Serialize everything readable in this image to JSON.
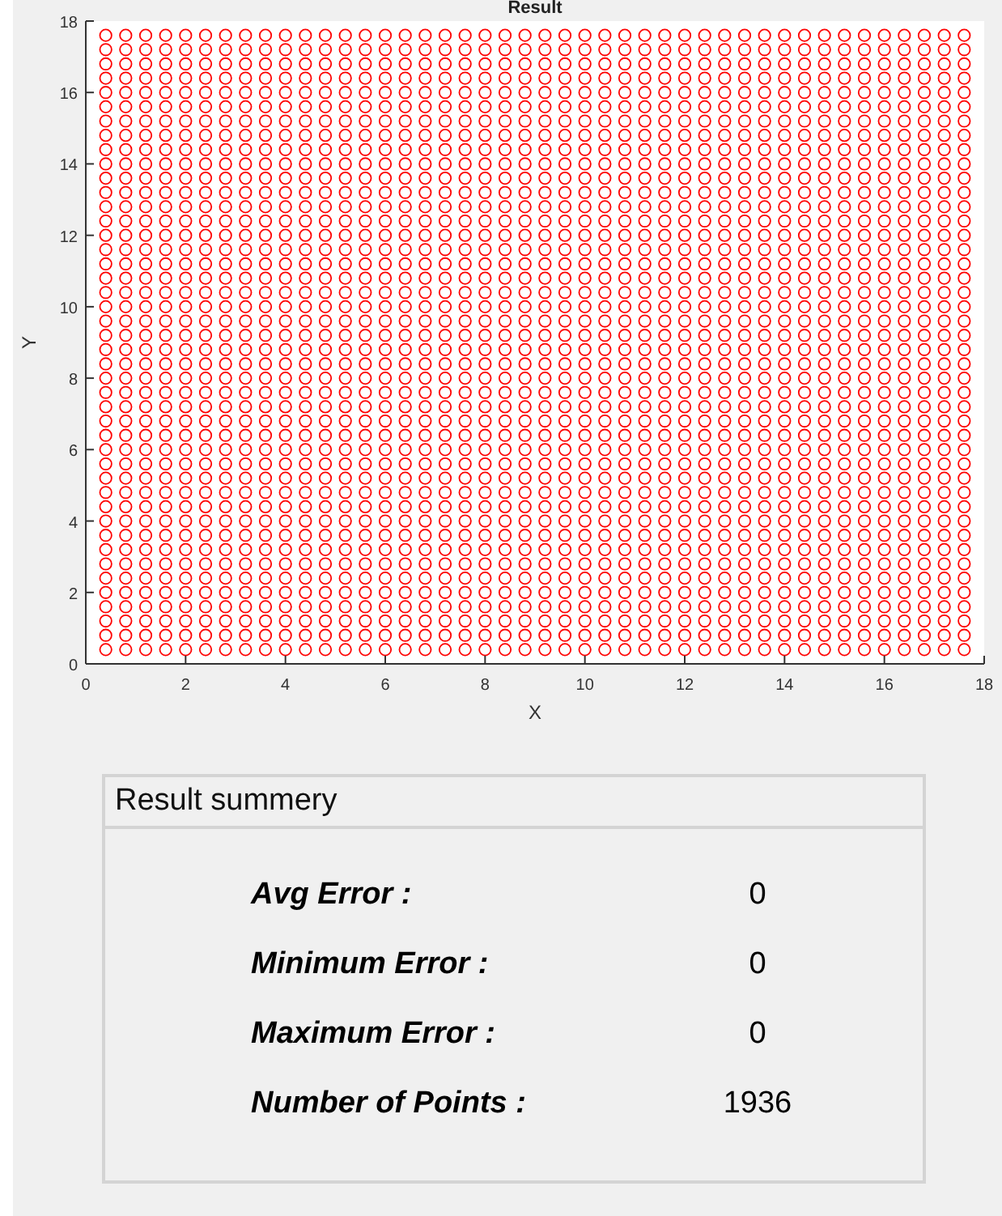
{
  "figure": {
    "chart_data": {
      "type": "scatter",
      "title": "Result",
      "xlabel": "X",
      "ylabel": "Y",
      "xlim": [
        0,
        18
      ],
      "ylim": [
        0,
        18
      ],
      "xticks": [
        0,
        2,
        4,
        6,
        8,
        10,
        12,
        14,
        16,
        18
      ],
      "yticks": [
        0,
        2,
        4,
        6,
        8,
        10,
        12,
        14,
        16,
        18
      ],
      "x": [
        0.4,
        0.8,
        1.2,
        1.6,
        2,
        2.4,
        2.8,
        3.2,
        3.6,
        4,
        4.4,
        4.8,
        5.2,
        5.6,
        6,
        6.4,
        6.8,
        7.2,
        7.6,
        8,
        8.4,
        8.8,
        9.2,
        9.6,
        10,
        10.4,
        10.8,
        11.2,
        11.6,
        12,
        12.4,
        12.8,
        13.2,
        13.6,
        14,
        14.4,
        14.8,
        15.2,
        15.6,
        16,
        16.4,
        16.8,
        17.2,
        17.6
      ],
      "series": [
        {
          "color": "#ff0000",
          "values": [
            0.4,
            0.4,
            0.4,
            0.4,
            0.4,
            0.4,
            0.4,
            0.4,
            0.4,
            0.4,
            0.4,
            0.4,
            0.4,
            0.4,
            0.4,
            0.4,
            0.4,
            0.4,
            0.4,
            0.4,
            0.4,
            0.4,
            0.4,
            0.4,
            0.4,
            0.4,
            0.4,
            0.4,
            0.4,
            0.4,
            0.4,
            0.4,
            0.4,
            0.4,
            0.4,
            0.4,
            0.4,
            0.4,
            0.4,
            0.4,
            0.4,
            0.4,
            0.4,
            0.4
          ]
        },
        {
          "color": "#ff0000",
          "values": [
            0.8,
            0.8,
            0.8,
            0.8,
            0.8,
            0.8,
            0.8,
            0.8,
            0.8,
            0.8,
            0.8,
            0.8,
            0.8,
            0.8,
            0.8,
            0.8,
            0.8,
            0.8,
            0.8,
            0.8,
            0.8,
            0.8,
            0.8,
            0.8,
            0.8,
            0.8,
            0.8,
            0.8,
            0.8,
            0.8,
            0.8,
            0.8,
            0.8,
            0.8,
            0.8,
            0.8,
            0.8,
            0.8,
            0.8,
            0.8,
            0.8,
            0.8,
            0.8,
            0.8
          ]
        },
        {
          "color": "#ff0000",
          "values": [
            1.2,
            1.2,
            1.2,
            1.2,
            1.2,
            1.2,
            1.2,
            1.2,
            1.2,
            1.2,
            1.2,
            1.2,
            1.2,
            1.2,
            1.2,
            1.2,
            1.2,
            1.2,
            1.2,
            1.2,
            1.2,
            1.2,
            1.2,
            1.2,
            1.2,
            1.2,
            1.2,
            1.2,
            1.2,
            1.2,
            1.2,
            1.2,
            1.2,
            1.2,
            1.2,
            1.2,
            1.2,
            1.2,
            1.2,
            1.2,
            1.2,
            1.2,
            1.2,
            1.2
          ]
        },
        {
          "color": "#ff0000",
          "values": [
            1.6,
            1.6,
            1.6,
            1.6,
            1.6,
            1.6,
            1.6,
            1.6,
            1.6,
            1.6,
            1.6,
            1.6,
            1.6,
            1.6,
            1.6,
            1.6,
            1.6,
            1.6,
            1.6,
            1.6,
            1.6,
            1.6,
            1.6,
            1.6,
            1.6,
            1.6,
            1.6,
            1.6,
            1.6,
            1.6,
            1.6,
            1.6,
            1.6,
            1.6,
            1.6,
            1.6,
            1.6,
            1.6,
            1.6,
            1.6,
            1.6,
            1.6,
            1.6,
            1.6
          ]
        },
        {
          "color": "#ff0000",
          "values": [
            2,
            2,
            2,
            2,
            2,
            2,
            2,
            2,
            2,
            2,
            2,
            2,
            2,
            2,
            2,
            2,
            2,
            2,
            2,
            2,
            2,
            2,
            2,
            2,
            2,
            2,
            2,
            2,
            2,
            2,
            2,
            2,
            2,
            2,
            2,
            2,
            2,
            2,
            2,
            2,
            2,
            2,
            2,
            2
          ]
        },
        {
          "color": "#ff0000",
          "values": [
            2.4,
            2.4,
            2.4,
            2.4,
            2.4,
            2.4,
            2.4,
            2.4,
            2.4,
            2.4,
            2.4,
            2.4,
            2.4,
            2.4,
            2.4,
            2.4,
            2.4,
            2.4,
            2.4,
            2.4,
            2.4,
            2.4,
            2.4,
            2.4,
            2.4,
            2.4,
            2.4,
            2.4,
            2.4,
            2.4,
            2.4,
            2.4,
            2.4,
            2.4,
            2.4,
            2.4,
            2.4,
            2.4,
            2.4,
            2.4,
            2.4,
            2.4,
            2.4,
            2.4
          ]
        },
        {
          "color": "#ff0000",
          "values": [
            2.8,
            2.8,
            2.8,
            2.8,
            2.8,
            2.8,
            2.8,
            2.8,
            2.8,
            2.8,
            2.8,
            2.8,
            2.8,
            2.8,
            2.8,
            2.8,
            2.8,
            2.8,
            2.8,
            2.8,
            2.8,
            2.8,
            2.8,
            2.8,
            2.8,
            2.8,
            2.8,
            2.8,
            2.8,
            2.8,
            2.8,
            2.8,
            2.8,
            2.8,
            2.8,
            2.8,
            2.8,
            2.8,
            2.8,
            2.8,
            2.8,
            2.8,
            2.8,
            2.8
          ]
        },
        {
          "color": "#ff0000",
          "values": [
            3.2,
            3.2,
            3.2,
            3.2,
            3.2,
            3.2,
            3.2,
            3.2,
            3.2,
            3.2,
            3.2,
            3.2,
            3.2,
            3.2,
            3.2,
            3.2,
            3.2,
            3.2,
            3.2,
            3.2,
            3.2,
            3.2,
            3.2,
            3.2,
            3.2,
            3.2,
            3.2,
            3.2,
            3.2,
            3.2,
            3.2,
            3.2,
            3.2,
            3.2,
            3.2,
            3.2,
            3.2,
            3.2,
            3.2,
            3.2,
            3.2,
            3.2,
            3.2,
            3.2
          ]
        },
        {
          "color": "#ff0000",
          "values": [
            3.6,
            3.6,
            3.6,
            3.6,
            3.6,
            3.6,
            3.6,
            3.6,
            3.6,
            3.6,
            3.6,
            3.6,
            3.6,
            3.6,
            3.6,
            3.6,
            3.6,
            3.6,
            3.6,
            3.6,
            3.6,
            3.6,
            3.6,
            3.6,
            3.6,
            3.6,
            3.6,
            3.6,
            3.6,
            3.6,
            3.6,
            3.6,
            3.6,
            3.6,
            3.6,
            3.6,
            3.6,
            3.6,
            3.6,
            3.6,
            3.6,
            3.6,
            3.6,
            3.6
          ]
        },
        {
          "color": "#ff0000",
          "values": [
            4,
            4,
            4,
            4,
            4,
            4,
            4,
            4,
            4,
            4,
            4,
            4,
            4,
            4,
            4,
            4,
            4,
            4,
            4,
            4,
            4,
            4,
            4,
            4,
            4,
            4,
            4,
            4,
            4,
            4,
            4,
            4,
            4,
            4,
            4,
            4,
            4,
            4,
            4,
            4,
            4,
            4,
            4,
            4
          ]
        },
        {
          "color": "#ff0000",
          "values": [
            4.4,
            4.4,
            4.4,
            4.4,
            4.4,
            4.4,
            4.4,
            4.4,
            4.4,
            4.4,
            4.4,
            4.4,
            4.4,
            4.4,
            4.4,
            4.4,
            4.4,
            4.4,
            4.4,
            4.4,
            4.4,
            4.4,
            4.4,
            4.4,
            4.4,
            4.4,
            4.4,
            4.4,
            4.4,
            4.4,
            4.4,
            4.4,
            4.4,
            4.4,
            4.4,
            4.4,
            4.4,
            4.4,
            4.4,
            4.4,
            4.4,
            4.4,
            4.4,
            4.4
          ]
        },
        {
          "color": "#ff0000",
          "values": [
            4.8,
            4.8,
            4.8,
            4.8,
            4.8,
            4.8,
            4.8,
            4.8,
            4.8,
            4.8,
            4.8,
            4.8,
            4.8,
            4.8,
            4.8,
            4.8,
            4.8,
            4.8,
            4.8,
            4.8,
            4.8,
            4.8,
            4.8,
            4.8,
            4.8,
            4.8,
            4.8,
            4.8,
            4.8,
            4.8,
            4.8,
            4.8,
            4.8,
            4.8,
            4.8,
            4.8,
            4.8,
            4.8,
            4.8,
            4.8,
            4.8,
            4.8,
            4.8,
            4.8
          ]
        },
        {
          "color": "#ff0000",
          "values": [
            5.2,
            5.2,
            5.2,
            5.2,
            5.2,
            5.2,
            5.2,
            5.2,
            5.2,
            5.2,
            5.2,
            5.2,
            5.2,
            5.2,
            5.2,
            5.2,
            5.2,
            5.2,
            5.2,
            5.2,
            5.2,
            5.2,
            5.2,
            5.2,
            5.2,
            5.2,
            5.2,
            5.2,
            5.2,
            5.2,
            5.2,
            5.2,
            5.2,
            5.2,
            5.2,
            5.2,
            5.2,
            5.2,
            5.2,
            5.2,
            5.2,
            5.2,
            5.2,
            5.2
          ]
        },
        {
          "color": "#ff0000",
          "values": [
            5.6,
            5.6,
            5.6,
            5.6,
            5.6,
            5.6,
            5.6,
            5.6,
            5.6,
            5.6,
            5.6,
            5.6,
            5.6,
            5.6,
            5.6,
            5.6,
            5.6,
            5.6,
            5.6,
            5.6,
            5.6,
            5.6,
            5.6,
            5.6,
            5.6,
            5.6,
            5.6,
            5.6,
            5.6,
            5.6,
            5.6,
            5.6,
            5.6,
            5.6,
            5.6,
            5.6,
            5.6,
            5.6,
            5.6,
            5.6,
            5.6,
            5.6,
            5.6,
            5.6
          ]
        },
        {
          "color": "#ff0000",
          "values": [
            6,
            6,
            6,
            6,
            6,
            6,
            6,
            6,
            6,
            6,
            6,
            6,
            6,
            6,
            6,
            6,
            6,
            6,
            6,
            6,
            6,
            6,
            6,
            6,
            6,
            6,
            6,
            6,
            6,
            6,
            6,
            6,
            6,
            6,
            6,
            6,
            6,
            6,
            6,
            6,
            6,
            6,
            6,
            6
          ]
        },
        {
          "color": "#ff0000",
          "values": [
            6.4,
            6.4,
            6.4,
            6.4,
            6.4,
            6.4,
            6.4,
            6.4,
            6.4,
            6.4,
            6.4,
            6.4,
            6.4,
            6.4,
            6.4,
            6.4,
            6.4,
            6.4,
            6.4,
            6.4,
            6.4,
            6.4,
            6.4,
            6.4,
            6.4,
            6.4,
            6.4,
            6.4,
            6.4,
            6.4,
            6.4,
            6.4,
            6.4,
            6.4,
            6.4,
            6.4,
            6.4,
            6.4,
            6.4,
            6.4,
            6.4,
            6.4,
            6.4,
            6.4
          ]
        },
        {
          "color": "#ff0000",
          "values": [
            6.8,
            6.8,
            6.8,
            6.8,
            6.8,
            6.8,
            6.8,
            6.8,
            6.8,
            6.8,
            6.8,
            6.8,
            6.8,
            6.8,
            6.8,
            6.8,
            6.8,
            6.8,
            6.8,
            6.8,
            6.8,
            6.8,
            6.8,
            6.8,
            6.8,
            6.8,
            6.8,
            6.8,
            6.8,
            6.8,
            6.8,
            6.8,
            6.8,
            6.8,
            6.8,
            6.8,
            6.8,
            6.8,
            6.8,
            6.8,
            6.8,
            6.8,
            6.8,
            6.8
          ]
        },
        {
          "color": "#ff0000",
          "values": [
            7.2,
            7.2,
            7.2,
            7.2,
            7.2,
            7.2,
            7.2,
            7.2,
            7.2,
            7.2,
            7.2,
            7.2,
            7.2,
            7.2,
            7.2,
            7.2,
            7.2,
            7.2,
            7.2,
            7.2,
            7.2,
            7.2,
            7.2,
            7.2,
            7.2,
            7.2,
            7.2,
            7.2,
            7.2,
            7.2,
            7.2,
            7.2,
            7.2,
            7.2,
            7.2,
            7.2,
            7.2,
            7.2,
            7.2,
            7.2,
            7.2,
            7.2,
            7.2,
            7.2
          ]
        },
        {
          "color": "#ff0000",
          "values": [
            7.6,
            7.6,
            7.6,
            7.6,
            7.6,
            7.6,
            7.6,
            7.6,
            7.6,
            7.6,
            7.6,
            7.6,
            7.6,
            7.6,
            7.6,
            7.6,
            7.6,
            7.6,
            7.6,
            7.6,
            7.6,
            7.6,
            7.6,
            7.6,
            7.6,
            7.6,
            7.6,
            7.6,
            7.6,
            7.6,
            7.6,
            7.6,
            7.6,
            7.6,
            7.6,
            7.6,
            7.6,
            7.6,
            7.6,
            7.6,
            7.6,
            7.6,
            7.6,
            7.6
          ]
        },
        {
          "color": "#ff0000",
          "values": [
            8,
            8,
            8,
            8,
            8,
            8,
            8,
            8,
            8,
            8,
            8,
            8,
            8,
            8,
            8,
            8,
            8,
            8,
            8,
            8,
            8,
            8,
            8,
            8,
            8,
            8,
            8,
            8,
            8,
            8,
            8,
            8,
            8,
            8,
            8,
            8,
            8,
            8,
            8,
            8,
            8,
            8,
            8,
            8
          ]
        },
        {
          "color": "#ff0000",
          "values": [
            8.4,
            8.4,
            8.4,
            8.4,
            8.4,
            8.4,
            8.4,
            8.4,
            8.4,
            8.4,
            8.4,
            8.4,
            8.4,
            8.4,
            8.4,
            8.4,
            8.4,
            8.4,
            8.4,
            8.4,
            8.4,
            8.4,
            8.4,
            8.4,
            8.4,
            8.4,
            8.4,
            8.4,
            8.4,
            8.4,
            8.4,
            8.4,
            8.4,
            8.4,
            8.4,
            8.4,
            8.4,
            8.4,
            8.4,
            8.4,
            8.4,
            8.4,
            8.4,
            8.4
          ]
        },
        {
          "color": "#ff0000",
          "values": [
            8.8,
            8.8,
            8.8,
            8.8,
            8.8,
            8.8,
            8.8,
            8.8,
            8.8,
            8.8,
            8.8,
            8.8,
            8.8,
            8.8,
            8.8,
            8.8,
            8.8,
            8.8,
            8.8,
            8.8,
            8.8,
            8.8,
            8.8,
            8.8,
            8.8,
            8.8,
            8.8,
            8.8,
            8.8,
            8.8,
            8.8,
            8.8,
            8.8,
            8.8,
            8.8,
            8.8,
            8.8,
            8.8,
            8.8,
            8.8,
            8.8,
            8.8,
            8.8,
            8.8
          ]
        },
        {
          "color": "#ff0000",
          "values": [
            9.2,
            9.2,
            9.2,
            9.2,
            9.2,
            9.2,
            9.2,
            9.2,
            9.2,
            9.2,
            9.2,
            9.2,
            9.2,
            9.2,
            9.2,
            9.2,
            9.2,
            9.2,
            9.2,
            9.2,
            9.2,
            9.2,
            9.2,
            9.2,
            9.2,
            9.2,
            9.2,
            9.2,
            9.2,
            9.2,
            9.2,
            9.2,
            9.2,
            9.2,
            9.2,
            9.2,
            9.2,
            9.2,
            9.2,
            9.2,
            9.2,
            9.2,
            9.2,
            9.2
          ]
        },
        {
          "color": "#ff0000",
          "values": [
            9.6,
            9.6,
            9.6,
            9.6,
            9.6,
            9.6,
            9.6,
            9.6,
            9.6,
            9.6,
            9.6,
            9.6,
            9.6,
            9.6,
            9.6,
            9.6,
            9.6,
            9.6,
            9.6,
            9.6,
            9.6,
            9.6,
            9.6,
            9.6,
            9.6,
            9.6,
            9.6,
            9.6,
            9.6,
            9.6,
            9.6,
            9.6,
            9.6,
            9.6,
            9.6,
            9.6,
            9.6,
            9.6,
            9.6,
            9.6,
            9.6,
            9.6,
            9.6,
            9.6
          ]
        },
        {
          "color": "#ff0000",
          "values": [
            10,
            10,
            10,
            10,
            10,
            10,
            10,
            10,
            10,
            10,
            10,
            10,
            10,
            10,
            10,
            10,
            10,
            10,
            10,
            10,
            10,
            10,
            10,
            10,
            10,
            10,
            10,
            10,
            10,
            10,
            10,
            10,
            10,
            10,
            10,
            10,
            10,
            10,
            10,
            10,
            10,
            10,
            10,
            10
          ]
        },
        {
          "color": "#ff0000",
          "values": [
            10.4,
            10.4,
            10.4,
            10.4,
            10.4,
            10.4,
            10.4,
            10.4,
            10.4,
            10.4,
            10.4,
            10.4,
            10.4,
            10.4,
            10.4,
            10.4,
            10.4,
            10.4,
            10.4,
            10.4,
            10.4,
            10.4,
            10.4,
            10.4,
            10.4,
            10.4,
            10.4,
            10.4,
            10.4,
            10.4,
            10.4,
            10.4,
            10.4,
            10.4,
            10.4,
            10.4,
            10.4,
            10.4,
            10.4,
            10.4,
            10.4,
            10.4,
            10.4,
            10.4
          ]
        },
        {
          "color": "#ff0000",
          "values": [
            10.8,
            10.8,
            10.8,
            10.8,
            10.8,
            10.8,
            10.8,
            10.8,
            10.8,
            10.8,
            10.8,
            10.8,
            10.8,
            10.8,
            10.8,
            10.8,
            10.8,
            10.8,
            10.8,
            10.8,
            10.8,
            10.8,
            10.8,
            10.8,
            10.8,
            10.8,
            10.8,
            10.8,
            10.8,
            10.8,
            10.8,
            10.8,
            10.8,
            10.8,
            10.8,
            10.8,
            10.8,
            10.8,
            10.8,
            10.8,
            10.8,
            10.8,
            10.8,
            10.8
          ]
        },
        {
          "color": "#ff0000",
          "values": [
            11.2,
            11.2,
            11.2,
            11.2,
            11.2,
            11.2,
            11.2,
            11.2,
            11.2,
            11.2,
            11.2,
            11.2,
            11.2,
            11.2,
            11.2,
            11.2,
            11.2,
            11.2,
            11.2,
            11.2,
            11.2,
            11.2,
            11.2,
            11.2,
            11.2,
            11.2,
            11.2,
            11.2,
            11.2,
            11.2,
            11.2,
            11.2,
            11.2,
            11.2,
            11.2,
            11.2,
            11.2,
            11.2,
            11.2,
            11.2,
            11.2,
            11.2,
            11.2,
            11.2
          ]
        },
        {
          "color": "#ff0000",
          "values": [
            11.6,
            11.6,
            11.6,
            11.6,
            11.6,
            11.6,
            11.6,
            11.6,
            11.6,
            11.6,
            11.6,
            11.6,
            11.6,
            11.6,
            11.6,
            11.6,
            11.6,
            11.6,
            11.6,
            11.6,
            11.6,
            11.6,
            11.6,
            11.6,
            11.6,
            11.6,
            11.6,
            11.6,
            11.6,
            11.6,
            11.6,
            11.6,
            11.6,
            11.6,
            11.6,
            11.6,
            11.6,
            11.6,
            11.6,
            11.6,
            11.6,
            11.6,
            11.6,
            11.6
          ]
        },
        {
          "color": "#ff0000",
          "values": [
            12,
            12,
            12,
            12,
            12,
            12,
            12,
            12,
            12,
            12,
            12,
            12,
            12,
            12,
            12,
            12,
            12,
            12,
            12,
            12,
            12,
            12,
            12,
            12,
            12,
            12,
            12,
            12,
            12,
            12,
            12,
            12,
            12,
            12,
            12,
            12,
            12,
            12,
            12,
            12,
            12,
            12,
            12,
            12
          ]
        },
        {
          "color": "#ff0000",
          "values": [
            12.4,
            12.4,
            12.4,
            12.4,
            12.4,
            12.4,
            12.4,
            12.4,
            12.4,
            12.4,
            12.4,
            12.4,
            12.4,
            12.4,
            12.4,
            12.4,
            12.4,
            12.4,
            12.4,
            12.4,
            12.4,
            12.4,
            12.4,
            12.4,
            12.4,
            12.4,
            12.4,
            12.4,
            12.4,
            12.4,
            12.4,
            12.4,
            12.4,
            12.4,
            12.4,
            12.4,
            12.4,
            12.4,
            12.4,
            12.4,
            12.4,
            12.4,
            12.4,
            12.4
          ]
        },
        {
          "color": "#ff0000",
          "values": [
            12.8,
            12.8,
            12.8,
            12.8,
            12.8,
            12.8,
            12.8,
            12.8,
            12.8,
            12.8,
            12.8,
            12.8,
            12.8,
            12.8,
            12.8,
            12.8,
            12.8,
            12.8,
            12.8,
            12.8,
            12.8,
            12.8,
            12.8,
            12.8,
            12.8,
            12.8,
            12.8,
            12.8,
            12.8,
            12.8,
            12.8,
            12.8,
            12.8,
            12.8,
            12.8,
            12.8,
            12.8,
            12.8,
            12.8,
            12.8,
            12.8,
            12.8,
            12.8,
            12.8
          ]
        },
        {
          "color": "#ff0000",
          "values": [
            13.2,
            13.2,
            13.2,
            13.2,
            13.2,
            13.2,
            13.2,
            13.2,
            13.2,
            13.2,
            13.2,
            13.2,
            13.2,
            13.2,
            13.2,
            13.2,
            13.2,
            13.2,
            13.2,
            13.2,
            13.2,
            13.2,
            13.2,
            13.2,
            13.2,
            13.2,
            13.2,
            13.2,
            13.2,
            13.2,
            13.2,
            13.2,
            13.2,
            13.2,
            13.2,
            13.2,
            13.2,
            13.2,
            13.2,
            13.2,
            13.2,
            13.2,
            13.2,
            13.2
          ]
        },
        {
          "color": "#ff0000",
          "values": [
            13.6,
            13.6,
            13.6,
            13.6,
            13.6,
            13.6,
            13.6,
            13.6,
            13.6,
            13.6,
            13.6,
            13.6,
            13.6,
            13.6,
            13.6,
            13.6,
            13.6,
            13.6,
            13.6,
            13.6,
            13.6,
            13.6,
            13.6,
            13.6,
            13.6,
            13.6,
            13.6,
            13.6,
            13.6,
            13.6,
            13.6,
            13.6,
            13.6,
            13.6,
            13.6,
            13.6,
            13.6,
            13.6,
            13.6,
            13.6,
            13.6,
            13.6,
            13.6,
            13.6
          ]
        },
        {
          "color": "#ff0000",
          "values": [
            14,
            14,
            14,
            14,
            14,
            14,
            14,
            14,
            14,
            14,
            14,
            14,
            14,
            14,
            14,
            14,
            14,
            14,
            14,
            14,
            14,
            14,
            14,
            14,
            14,
            14,
            14,
            14,
            14,
            14,
            14,
            14,
            14,
            14,
            14,
            14,
            14,
            14,
            14,
            14,
            14,
            14,
            14,
            14
          ]
        },
        {
          "color": "#ff0000",
          "values": [
            14.4,
            14.4,
            14.4,
            14.4,
            14.4,
            14.4,
            14.4,
            14.4,
            14.4,
            14.4,
            14.4,
            14.4,
            14.4,
            14.4,
            14.4,
            14.4,
            14.4,
            14.4,
            14.4,
            14.4,
            14.4,
            14.4,
            14.4,
            14.4,
            14.4,
            14.4,
            14.4,
            14.4,
            14.4,
            14.4,
            14.4,
            14.4,
            14.4,
            14.4,
            14.4,
            14.4,
            14.4,
            14.4,
            14.4,
            14.4,
            14.4,
            14.4,
            14.4,
            14.4
          ]
        },
        {
          "color": "#ff0000",
          "values": [
            14.8,
            14.8,
            14.8,
            14.8,
            14.8,
            14.8,
            14.8,
            14.8,
            14.8,
            14.8,
            14.8,
            14.8,
            14.8,
            14.8,
            14.8,
            14.8,
            14.8,
            14.8,
            14.8,
            14.8,
            14.8,
            14.8,
            14.8,
            14.8,
            14.8,
            14.8,
            14.8,
            14.8,
            14.8,
            14.8,
            14.8,
            14.8,
            14.8,
            14.8,
            14.8,
            14.8,
            14.8,
            14.8,
            14.8,
            14.8,
            14.8,
            14.8,
            14.8,
            14.8
          ]
        },
        {
          "color": "#ff0000",
          "values": [
            15.2,
            15.2,
            15.2,
            15.2,
            15.2,
            15.2,
            15.2,
            15.2,
            15.2,
            15.2,
            15.2,
            15.2,
            15.2,
            15.2,
            15.2,
            15.2,
            15.2,
            15.2,
            15.2,
            15.2,
            15.2,
            15.2,
            15.2,
            15.2,
            15.2,
            15.2,
            15.2,
            15.2,
            15.2,
            15.2,
            15.2,
            15.2,
            15.2,
            15.2,
            15.2,
            15.2,
            15.2,
            15.2,
            15.2,
            15.2,
            15.2,
            15.2,
            15.2,
            15.2
          ]
        },
        {
          "color": "#ff0000",
          "values": [
            15.6,
            15.6,
            15.6,
            15.6,
            15.6,
            15.6,
            15.6,
            15.6,
            15.6,
            15.6,
            15.6,
            15.6,
            15.6,
            15.6,
            15.6,
            15.6,
            15.6,
            15.6,
            15.6,
            15.6,
            15.6,
            15.6,
            15.6,
            15.6,
            15.6,
            15.6,
            15.6,
            15.6,
            15.6,
            15.6,
            15.6,
            15.6,
            15.6,
            15.6,
            15.6,
            15.6,
            15.6,
            15.6,
            15.6,
            15.6,
            15.6,
            15.6,
            15.6,
            15.6
          ]
        },
        {
          "color": "#ff0000",
          "values": [
            16,
            16,
            16,
            16,
            16,
            16,
            16,
            16,
            16,
            16,
            16,
            16,
            16,
            16,
            16,
            16,
            16,
            16,
            16,
            16,
            16,
            16,
            16,
            16,
            16,
            16,
            16,
            16,
            16,
            16,
            16,
            16,
            16,
            16,
            16,
            16,
            16,
            16,
            16,
            16,
            16,
            16,
            16,
            16
          ]
        },
        {
          "color": "#ff0000",
          "values": [
            16.4,
            16.4,
            16.4,
            16.4,
            16.4,
            16.4,
            16.4,
            16.4,
            16.4,
            16.4,
            16.4,
            16.4,
            16.4,
            16.4,
            16.4,
            16.4,
            16.4,
            16.4,
            16.4,
            16.4,
            16.4,
            16.4,
            16.4,
            16.4,
            16.4,
            16.4,
            16.4,
            16.4,
            16.4,
            16.4,
            16.4,
            16.4,
            16.4,
            16.4,
            16.4,
            16.4,
            16.4,
            16.4,
            16.4,
            16.4,
            16.4,
            16.4,
            16.4,
            16.4
          ]
        },
        {
          "color": "#ff0000",
          "values": [
            16.8,
            16.8,
            16.8,
            16.8,
            16.8,
            16.8,
            16.8,
            16.8,
            16.8,
            16.8,
            16.8,
            16.8,
            16.8,
            16.8,
            16.8,
            16.8,
            16.8,
            16.8,
            16.8,
            16.8,
            16.8,
            16.8,
            16.8,
            16.8,
            16.8,
            16.8,
            16.8,
            16.8,
            16.8,
            16.8,
            16.8,
            16.8,
            16.8,
            16.8,
            16.8,
            16.8,
            16.8,
            16.8,
            16.8,
            16.8,
            16.8,
            16.8,
            16.8,
            16.8
          ]
        },
        {
          "color": "#ff0000",
          "values": [
            17.2,
            17.2,
            17.2,
            17.2,
            17.2,
            17.2,
            17.2,
            17.2,
            17.2,
            17.2,
            17.2,
            17.2,
            17.2,
            17.2,
            17.2,
            17.2,
            17.2,
            17.2,
            17.2,
            17.2,
            17.2,
            17.2,
            17.2,
            17.2,
            17.2,
            17.2,
            17.2,
            17.2,
            17.2,
            17.2,
            17.2,
            17.2,
            17.2,
            17.2,
            17.2,
            17.2,
            17.2,
            17.2,
            17.2,
            17.2,
            17.2,
            17.2,
            17.2,
            17.2
          ]
        },
        {
          "color": "#ff0000",
          "values": [
            17.6,
            17.6,
            17.6,
            17.6,
            17.6,
            17.6,
            17.6,
            17.6,
            17.6,
            17.6,
            17.6,
            17.6,
            17.6,
            17.6,
            17.6,
            17.6,
            17.6,
            17.6,
            17.6,
            17.6,
            17.6,
            17.6,
            17.6,
            17.6,
            17.6,
            17.6,
            17.6,
            17.6,
            17.6,
            17.6,
            17.6,
            17.6,
            17.6,
            17.6,
            17.6,
            17.6,
            17.6,
            17.6,
            17.6,
            17.6,
            17.6,
            17.6,
            17.6,
            17.6
          ]
        }
      ]
    }
  },
  "summary": {
    "title": "Result summery",
    "rows": [
      {
        "label": "Avg Error :",
        "value": "0"
      },
      {
        "label": "Minimum Error :",
        "value": "0"
      },
      {
        "label": "Maximum Error :",
        "value": "0"
      },
      {
        "label": "Number of Points :",
        "value": "1936"
      }
    ]
  }
}
